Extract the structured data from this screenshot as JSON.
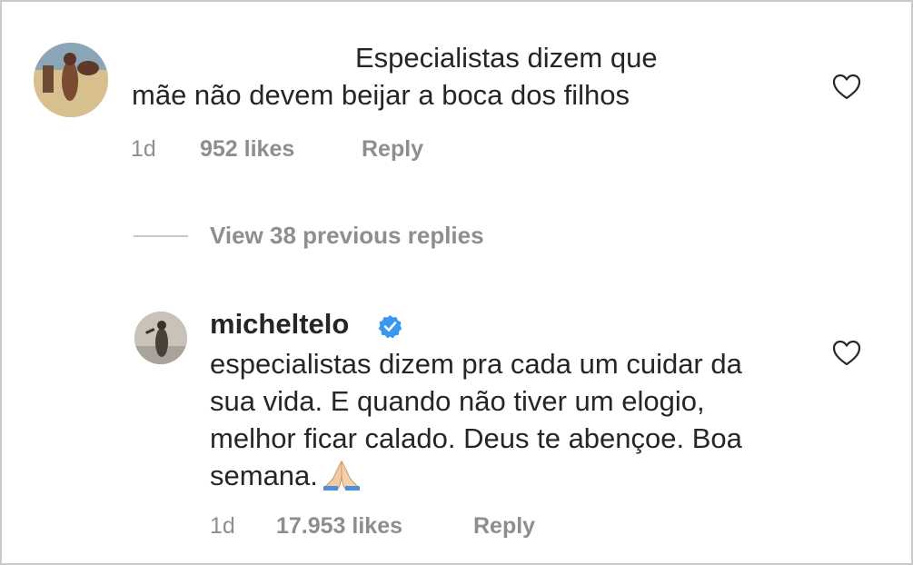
{
  "comment": {
    "line1": "Especialistas dizem que",
    "line2": "mãe não devem beijar a boca dos filhos",
    "time": "1d",
    "likes": "952 likes",
    "reply_label": "Reply"
  },
  "view_replies": "View 38 previous replies",
  "reply": {
    "username": "micheltelo",
    "text": "especialistas dizem pra cada um cuidar da sua vida. E quando não tiver um elogio, melhor ficar calado. Deus te abençoe. Boa semana.",
    "emoji": "praying-hands-icon",
    "time": "1d",
    "likes": "17.953 likes",
    "reply_label": "Reply"
  },
  "colors": {
    "text": "#262626",
    "meta": "#8e8e8e",
    "verified": "#3897f0"
  }
}
